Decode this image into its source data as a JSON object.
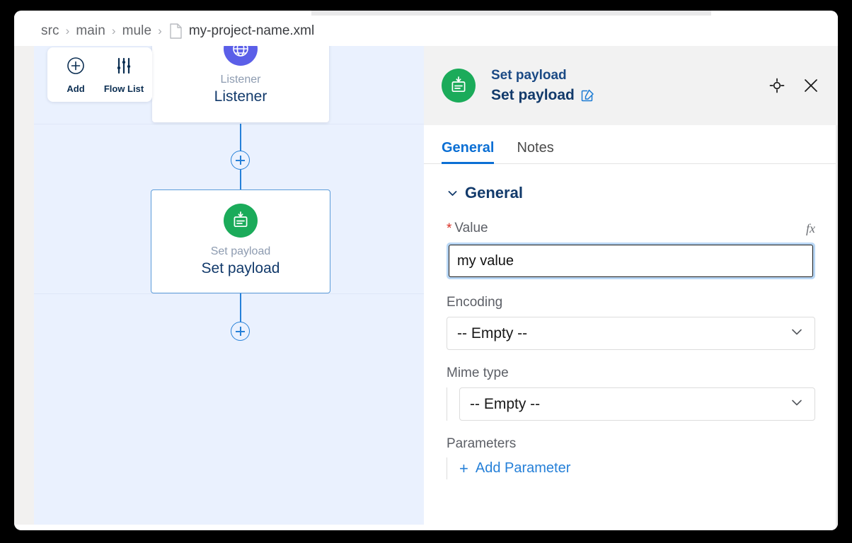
{
  "breadcrumb": {
    "items": [
      "src",
      "main",
      "mule"
    ],
    "separator": "›",
    "file": "my-project-name.xml",
    "file_icon": "file-icon"
  },
  "canvas": {
    "toolbar": {
      "add": {
        "label": "Add",
        "icon": "plus-circle-icon"
      },
      "flow_list": {
        "label": "Flow List",
        "icon": "sliders-icon"
      }
    },
    "nodes": [
      {
        "type": "Listener",
        "name": "Listener",
        "icon": "globe-icon",
        "icon_color": "#5b5fe8",
        "selected": false
      },
      {
        "type": "Set payload",
        "name": "Set payload",
        "icon": "set-payload-icon",
        "icon_color": "#1bab5a",
        "selected": true
      }
    ],
    "add_step_tooltip": "+",
    "background_color": "#eaf1fe",
    "connector_color": "#2680d8"
  },
  "panel": {
    "icon": "set-payload-icon",
    "subtitle": "Set payload",
    "title": "Set payload",
    "edit_icon": "edit-pencil-icon",
    "actions": [
      {
        "name": "focus-icon",
        "label": "Focus"
      },
      {
        "name": "close-icon",
        "label": "Close"
      }
    ],
    "tabs": [
      {
        "label": "General",
        "active": true
      },
      {
        "label": "Notes",
        "active": false
      }
    ],
    "section": {
      "label": "General",
      "collapse_icon": "chevron-down-icon",
      "expanded": true
    },
    "fields": {
      "value": {
        "label": "Value",
        "required": true,
        "required_marker": "*",
        "value": "my value",
        "placeholder": "",
        "fx_label": "fx",
        "focused": true
      },
      "encoding": {
        "label": "Encoding",
        "selected": "-- Empty --",
        "caret_icon": "chevron-down-icon"
      },
      "mime_type": {
        "label": "Mime type",
        "selected": "-- Empty --",
        "caret_icon": "chevron-down-icon"
      },
      "parameters": {
        "label": "Parameters",
        "add_label": "Add Parameter",
        "add_icon": "plus-icon"
      }
    }
  },
  "colors": {
    "accent_blue": "#2680d8",
    "tab_active_blue": "#0b6fd4",
    "title_navy": "#123a6b",
    "green": "#1bab5a",
    "purple": "#5b5fe8",
    "required_red": "#d93025",
    "canvas_bg": "#eaf1fe",
    "panel_header_bg": "#f2f2f2"
  }
}
